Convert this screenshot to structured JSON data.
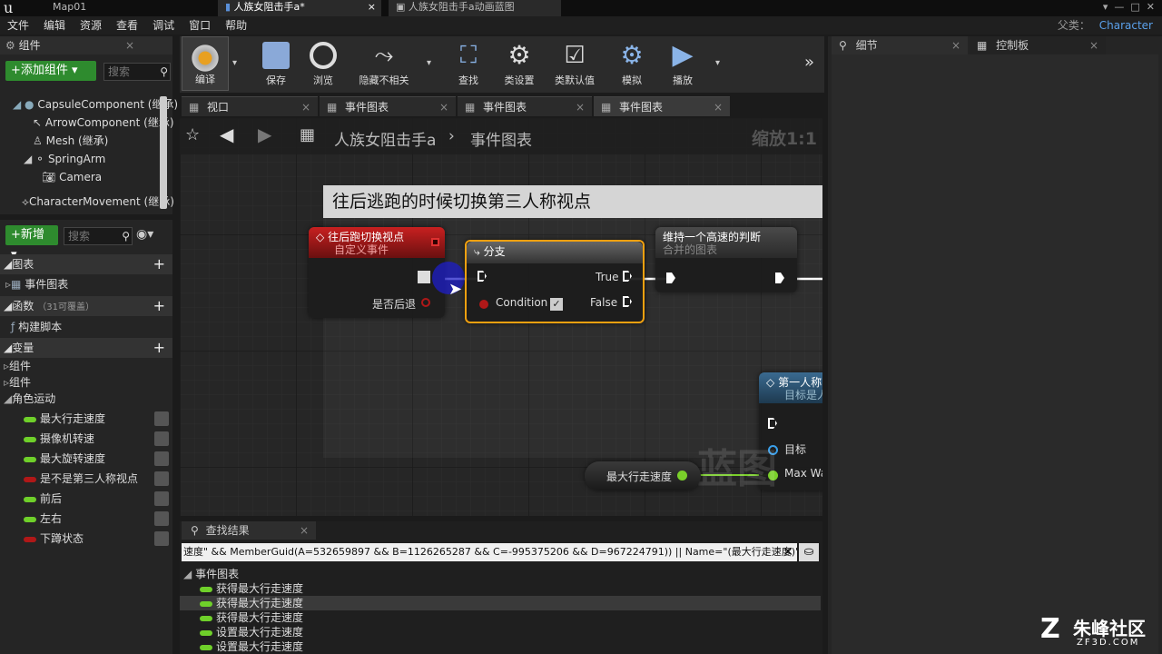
{
  "window_tabs": [
    {
      "label": "Map01"
    },
    {
      "label": "人族女阻击手a*"
    },
    {
      "label": "人族女阻击手a动画蓝图"
    }
  ],
  "menu": [
    "文件",
    "编辑",
    "资源",
    "查看",
    "调试",
    "窗口",
    "帮助"
  ],
  "parent_label": "父类：",
  "parent_class": "Character",
  "components_panel": {
    "title": "组件",
    "add_button": "+添加组件",
    "search_placeholder": "搜索",
    "items": [
      {
        "label": "CapsuleComponent (继承)"
      },
      {
        "label": "ArrowComponent (继承)"
      },
      {
        "label": "Mesh (继承)"
      },
      {
        "label": "SpringArm"
      },
      {
        "label": "Camera"
      },
      {
        "label": "CharacterMovement (继承)"
      }
    ]
  },
  "my_blueprint": {
    "new_button": "+新增",
    "search_placeholder": "搜索",
    "sections": {
      "graphs": "图表",
      "event_graph": "事件图表",
      "functions": "函数",
      "functions_note": "（31可覆盖）",
      "construction": "构建脚本",
      "variables": "变量"
    },
    "var_groups": [
      "组件",
      "组件",
      "角色运动"
    ],
    "variables": [
      {
        "label": "最大行走速度",
        "color": "#6fd02a"
      },
      {
        "label": "摄像机转速",
        "color": "#6fd02a"
      },
      {
        "label": "最大旋转速度",
        "color": "#6fd02a"
      },
      {
        "label": "是不是第三人称视点",
        "color": "#b01818"
      },
      {
        "label": "前后",
        "color": "#6fd02a"
      },
      {
        "label": "左右",
        "color": "#6fd02a"
      },
      {
        "label": "下蹲状态",
        "color": "#b01818"
      }
    ]
  },
  "toolbar": [
    {
      "label": "编译",
      "icon": "compile-icon"
    },
    {
      "label": "保存",
      "icon": "save-icon"
    },
    {
      "label": "浏览",
      "icon": "browse-icon"
    },
    {
      "label": "隐藏不相关",
      "icon": "hide-unrelated-icon"
    },
    {
      "label": "查找",
      "icon": "find-icon"
    },
    {
      "label": "类设置",
      "icon": "class-settings-icon"
    },
    {
      "label": "类默认值",
      "icon": "class-defaults-icon"
    },
    {
      "label": "模拟",
      "icon": "simulate-icon"
    },
    {
      "label": "播放",
      "icon": "play-icon"
    }
  ],
  "doc_tabs": [
    {
      "label": "视口"
    },
    {
      "label": "事件图表"
    },
    {
      "label": "事件图表"
    },
    {
      "label": "事件图表"
    }
  ],
  "graph": {
    "breadcrumb_root": "人族女阻击手a",
    "breadcrumb_leaf": "事件图表",
    "zoom": "缩放1:1",
    "comment": "往后逃跑的时候切换第三人称视点",
    "watermark": "蓝图",
    "event_node": {
      "title": "往后跑切换视点",
      "subtitle": "自定义事件",
      "pin": "是否后退"
    },
    "branch_node": {
      "title": "分支",
      "true": "True",
      "false": "False",
      "condition": "Condition"
    },
    "collapsed_node": {
      "title": "维持一个高速的判断",
      "subtitle": "合并的图表"
    },
    "func_node": {
      "title": "第一人称",
      "subtitle": "目标是人",
      "target": "目标",
      "maxwalk": "Max Wa"
    },
    "var_get": {
      "label": "最大行走速度"
    }
  },
  "find_results": {
    "title": "查找结果",
    "query": "速度\" && MemberGuid(A=532659897 && B=1126265287 && C=-995375206 && D=967224791)) || Name=\"(最大行走速度)\")",
    "group": "事件图表",
    "rows": [
      "获得最大行走速度",
      "获得最大行走速度",
      "获得最大行走速度",
      "设置最大行走速度",
      "设置最大行走速度"
    ]
  },
  "right_tabs": [
    {
      "label": "细节"
    },
    {
      "label": "控制板"
    }
  ],
  "brand": {
    "name": "朱峰社区",
    "site": "ZF3D.COM"
  }
}
